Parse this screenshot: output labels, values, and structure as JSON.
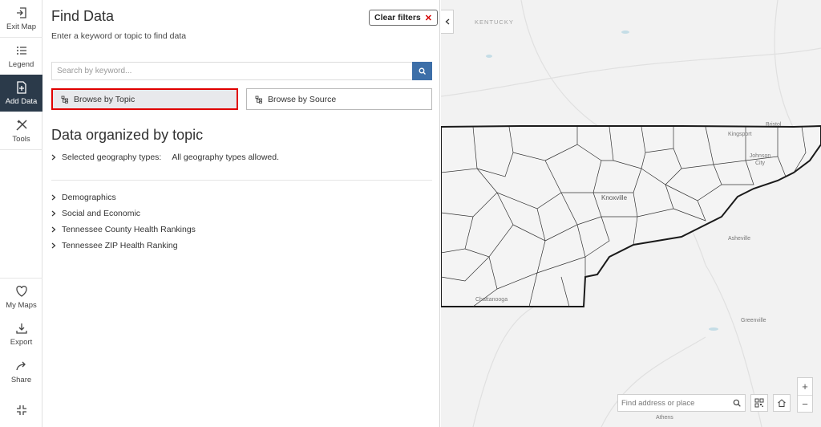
{
  "rail": {
    "top_items": [
      {
        "label": "Exit Map",
        "icon": "exit-icon"
      },
      {
        "label": "Legend",
        "icon": "legend-icon"
      },
      {
        "label": "Add Data",
        "icon": "add-data-icon",
        "active": true
      },
      {
        "label": "Tools",
        "icon": "tools-icon"
      }
    ],
    "bottom_items": [
      {
        "label": "My Maps",
        "icon": "heart-icon"
      },
      {
        "label": "Export",
        "icon": "download-icon"
      },
      {
        "label": "Share",
        "icon": "share-icon"
      },
      {
        "label": "",
        "icon": "collapse-arrows-icon"
      }
    ]
  },
  "panel": {
    "title": "Find Data",
    "subtitle": "Enter a keyword or topic to find data",
    "clear_filters": "Clear filters",
    "search_placeholder": "Search by keyword...",
    "browse_topic": "Browse by Topic",
    "browse_source": "Browse by Source",
    "section_title": "Data organized by topic",
    "geography_label": "Selected geography types:",
    "geography_value": "All geography types allowed.",
    "topics": [
      "Demographics",
      "Social and Economic",
      "Tennessee County Health Rankings",
      "Tennessee ZIP Health Ranking"
    ]
  },
  "map": {
    "labels": {
      "kentucky": "KENTUCKY",
      "bristol": "Bristol",
      "kingsport": "Kingsport",
      "johnson_city": "Johnson City",
      "knoxville": "Knoxville",
      "asheville": "Asheville",
      "chattanooga": "Chattanooga",
      "greenville": "Greenville",
      "athens": "Athens"
    },
    "find_placeholder": "Find address or place",
    "zoom_in": "+",
    "zoom_out": "−",
    "accent": "#3d6fa8",
    "highlight_border": "#e00000"
  }
}
